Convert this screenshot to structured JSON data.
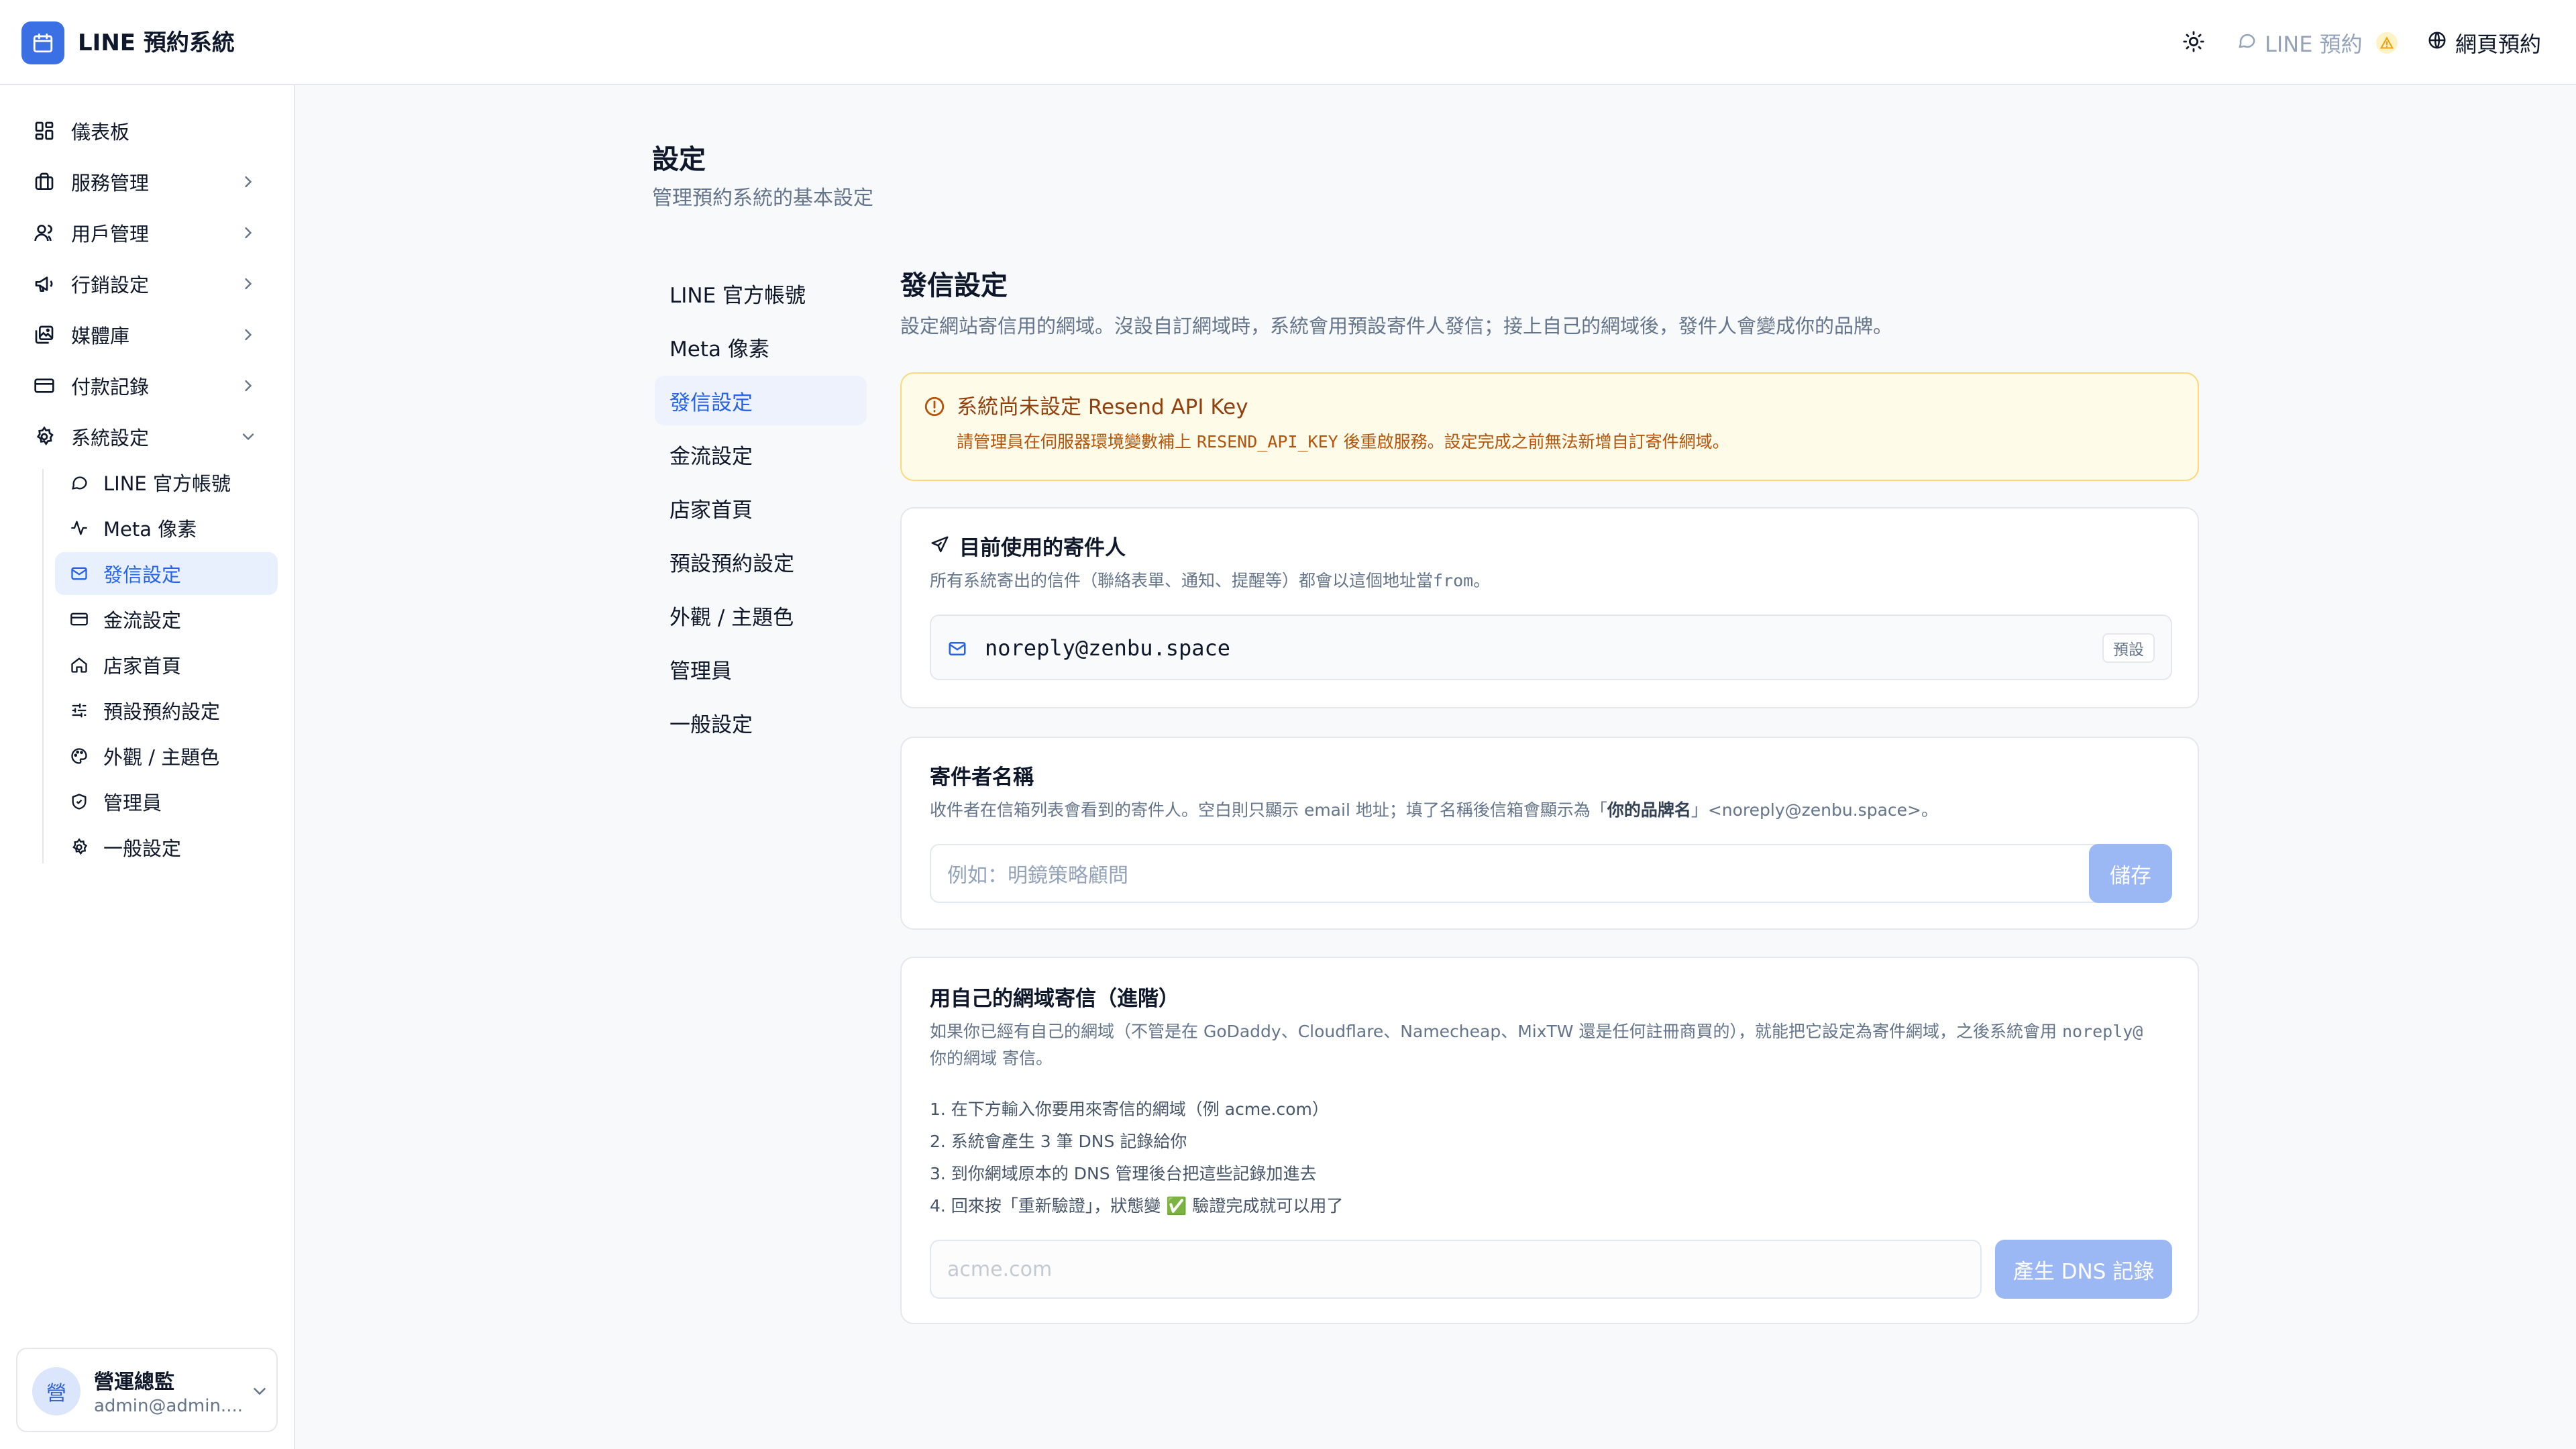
{
  "app": {
    "title": "LINE 預約系統"
  },
  "header": {
    "line_label": "LINE 預約",
    "web_booking_label": "網頁預約"
  },
  "sidebar": {
    "items": [
      {
        "label": "儀表板",
        "icon": "dashboard-icon"
      },
      {
        "label": "服務管理",
        "icon": "briefcase-icon"
      },
      {
        "label": "用戶管理",
        "icon": "users-icon"
      },
      {
        "label": "行銷設定",
        "icon": "megaphone-icon"
      },
      {
        "label": "媒體庫",
        "icon": "images-icon"
      },
      {
        "label": "付款記錄",
        "icon": "credit-card-icon"
      },
      {
        "label": "系統設定",
        "icon": "gear-icon"
      }
    ],
    "sub_items": [
      {
        "label": "LINE 官方帳號"
      },
      {
        "label": "Meta 像素"
      },
      {
        "label": "發信設定"
      },
      {
        "label": "金流設定"
      },
      {
        "label": "店家首頁"
      },
      {
        "label": "預設預約設定"
      },
      {
        "label": "外觀 / 主題色"
      },
      {
        "label": "管理員"
      },
      {
        "label": "一般設定"
      }
    ],
    "user": {
      "avatar_text": "營",
      "name": "營運總監",
      "email": "admin@admin...."
    }
  },
  "page": {
    "title": "設定",
    "subtitle": "管理預約系統的基本設定"
  },
  "settings_nav": [
    "LINE 官方帳號",
    "Meta 像素",
    "發信設定",
    "金流設定",
    "店家首頁",
    "預設預約設定",
    "外觀 / 主題色",
    "管理員",
    "一般設定"
  ],
  "section": {
    "title": "發信設定",
    "description": "設定網站寄信用的網域。沒設自訂網域時，系統會用預設寄件人發信；接上自己的網域後，發件人會變成你的品牌。"
  },
  "alert": {
    "title": "系統尚未設定 Resend API Key",
    "body_prefix": "請管理員在伺服器環境變數補上",
    "body_code": "RESEND_API_KEY",
    "body_suffix": "後重啟服務。設定完成之前無法新增自訂寄件網域。"
  },
  "current_sender": {
    "title": "目前使用的寄件人",
    "desc_prefix": "所有系統寄出的信件（聯絡表單、通知、提醒等）都會以這個地址當",
    "desc_code": "from",
    "desc_suffix": "。",
    "email": "noreply@zenbu.space",
    "badge": "預設"
  },
  "sender_name": {
    "title": "寄件者名稱",
    "desc_prefix": "收件者在信箱列表會看到的寄件人。空白則只顯示 email 地址；填了名稱後信箱會顯示為「",
    "desc_bold": "你的品牌名",
    "desc_suffix": "」<noreply@zenbu.space>。",
    "placeholder": "例如：明鏡策略顧問",
    "save_label": "儲存"
  },
  "custom_domain": {
    "title": "用自己的網域寄信（進階）",
    "desc_line1_prefix": "如果你已經有自己的網域（不管是在 GoDaddy、Cloudflare、Namecheap、MixTW 還是任何註冊商買的），就能把它設定為寄件網域，之後系統會用",
    "desc_line1_code": "noreply@",
    "desc_line2": "你的網域 寄信。",
    "steps": [
      "1. 在下方輸入你要用來寄信的網域（例 acme.com）",
      "2. 系統會產生 3 筆 DNS 記錄給你",
      "3. 到你網域原本的 DNS 管理後台把這些記錄加進去",
      "4. 回來按「重新驗證」，狀態變 ✅ 驗證完成就可以用了"
    ],
    "placeholder": "acme.com",
    "button_label": "產生 DNS 記錄"
  },
  "colors": {
    "accent": "#3b6fe4",
    "active_bg": "#e8effd",
    "warning_bg": "#fefbe8",
    "warning_border": "#fcd87a",
    "button_disabled": "#9cb8f4"
  }
}
